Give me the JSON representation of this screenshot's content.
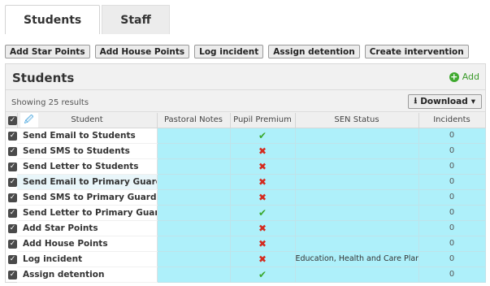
{
  "tabs": [
    {
      "label": "Students",
      "active": true
    },
    {
      "label": "Staff",
      "active": false
    }
  ],
  "actions": [
    "Add Star Points",
    "Add House Points",
    "Log incident",
    "Assign detention",
    "Create intervention"
  ],
  "panel": {
    "title": "Students",
    "add_label": "Add",
    "showing": "Showing 25 results",
    "download_label": "Download"
  },
  "table": {
    "columns": [
      "Student",
      "Pastoral Notes",
      "Pupil Premium",
      "SEN Status",
      "Incidents"
    ],
    "rows": [
      {
        "menu": "Send Email to Students",
        "premium": "tick",
        "sen": "",
        "incidents": "0"
      },
      {
        "menu": "Send SMS to Students",
        "premium": "cross",
        "sen": "",
        "incidents": "0"
      },
      {
        "menu": "Send Letter to Students",
        "premium": "cross",
        "sen": "",
        "incidents": "0"
      },
      {
        "menu": "Send Email to Primary Guardians",
        "premium": "cross",
        "sen": "",
        "incidents": "0"
      },
      {
        "menu": "Send SMS to Primary Guardians",
        "premium": "cross",
        "sen": "",
        "incidents": "0"
      },
      {
        "menu": "Send Letter to Primary Guardians",
        "premium": "tick",
        "sen": "",
        "incidents": "0"
      },
      {
        "menu": "Add Star Points",
        "premium": "cross",
        "sen": "",
        "incidents": "0"
      },
      {
        "menu": "Add House Points",
        "premium": "cross",
        "sen": "",
        "incidents": "0"
      },
      {
        "menu": "Log incident",
        "premium": "cross",
        "sen": "Education, Health and Care Plan",
        "incidents": "0"
      },
      {
        "menu": "Assign detention",
        "premium": "tick",
        "sen": "",
        "incidents": "0"
      }
    ]
  },
  "colors": {
    "accent_row": "#aef0fa",
    "tick": "#3aa82c",
    "cross": "#d42b1f",
    "add_green": "#3fa92f"
  },
  "icons": {
    "check": "checkbox-checked-icon",
    "wand": "magic-wand-icon",
    "download": "download-icon",
    "add": "plus-circle-icon"
  }
}
